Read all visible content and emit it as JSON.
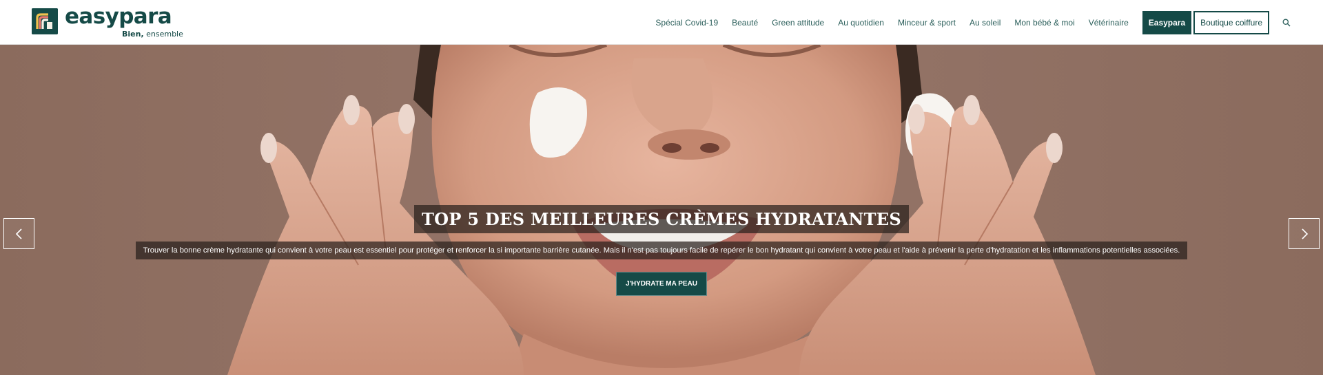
{
  "brand": {
    "name": "easypara",
    "tagline_bold": "Bien,",
    "tagline_rest": " ensemble",
    "color": "#154a47"
  },
  "nav": {
    "items": [
      {
        "label": "Spécial Covid-19"
      },
      {
        "label": "Beauté"
      },
      {
        "label": "Green attitude"
      },
      {
        "label": "Au quotidien"
      },
      {
        "label": "Minceur & sport"
      },
      {
        "label": "Au soleil"
      },
      {
        "label": "Mon bébé & moi"
      },
      {
        "label": "Vétérinaire"
      }
    ],
    "primary_button": "Easypara",
    "secondary_button": "Boutique coiffure",
    "search_icon": "search-icon"
  },
  "hero": {
    "title": "TOP 5 DES MEILLEURES CRÈMES HYDRATANTES",
    "text": "Trouver la bonne crème hydratante qui convient à votre peau est essentiel pour protéger et renforcer la si importante barrière cutanée. Mais il n'est pas toujours facile de repérer le bon hydratant qui convient à votre peau et l'aide à prévenir la perte d'hydratation et les inflammations potentielles associées.",
    "cta": "J'HYDRATE MA PEAU",
    "prev_icon": "chevron-left-icon",
    "next_icon": "chevron-right-icon"
  }
}
